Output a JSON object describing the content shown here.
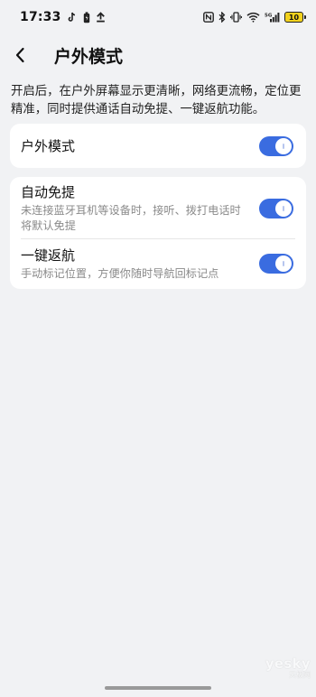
{
  "status_bar": {
    "time": "17:33",
    "battery_level": "10",
    "left_icons": [
      "tiktok-icon",
      "battery-saver-icon",
      "upload-icon"
    ],
    "right_icons": [
      "nfc-icon",
      "bluetooth-icon",
      "vibrate-icon",
      "wifi-icon",
      "signal-5g-icon",
      "battery-icon"
    ],
    "battery_color": "#f2d21e"
  },
  "header": {
    "back_icon": "chevron-left-icon",
    "title": "户外模式"
  },
  "description": "开启后，在户外屏幕显示更清晰，网络更流畅，定位更精准，同时提供通话自动免提、一键返航功能。",
  "settings": {
    "outdoor_mode": {
      "title": "户外模式",
      "enabled": true
    },
    "auto_handsfree": {
      "title": "自动免提",
      "subtitle": "未连接蓝牙耳机等设备时，接听、拨打电话时将默认免提",
      "enabled": true
    },
    "one_key_return": {
      "title": "一键返航",
      "subtitle": "手动标记位置，方便你随时导航回标记点",
      "enabled": true
    }
  },
  "colors": {
    "accent": "#3a6ce0",
    "background": "#f1f2f4",
    "card": "#ffffff"
  },
  "watermark": {
    "main": "yesky",
    "sub": "天极网"
  }
}
